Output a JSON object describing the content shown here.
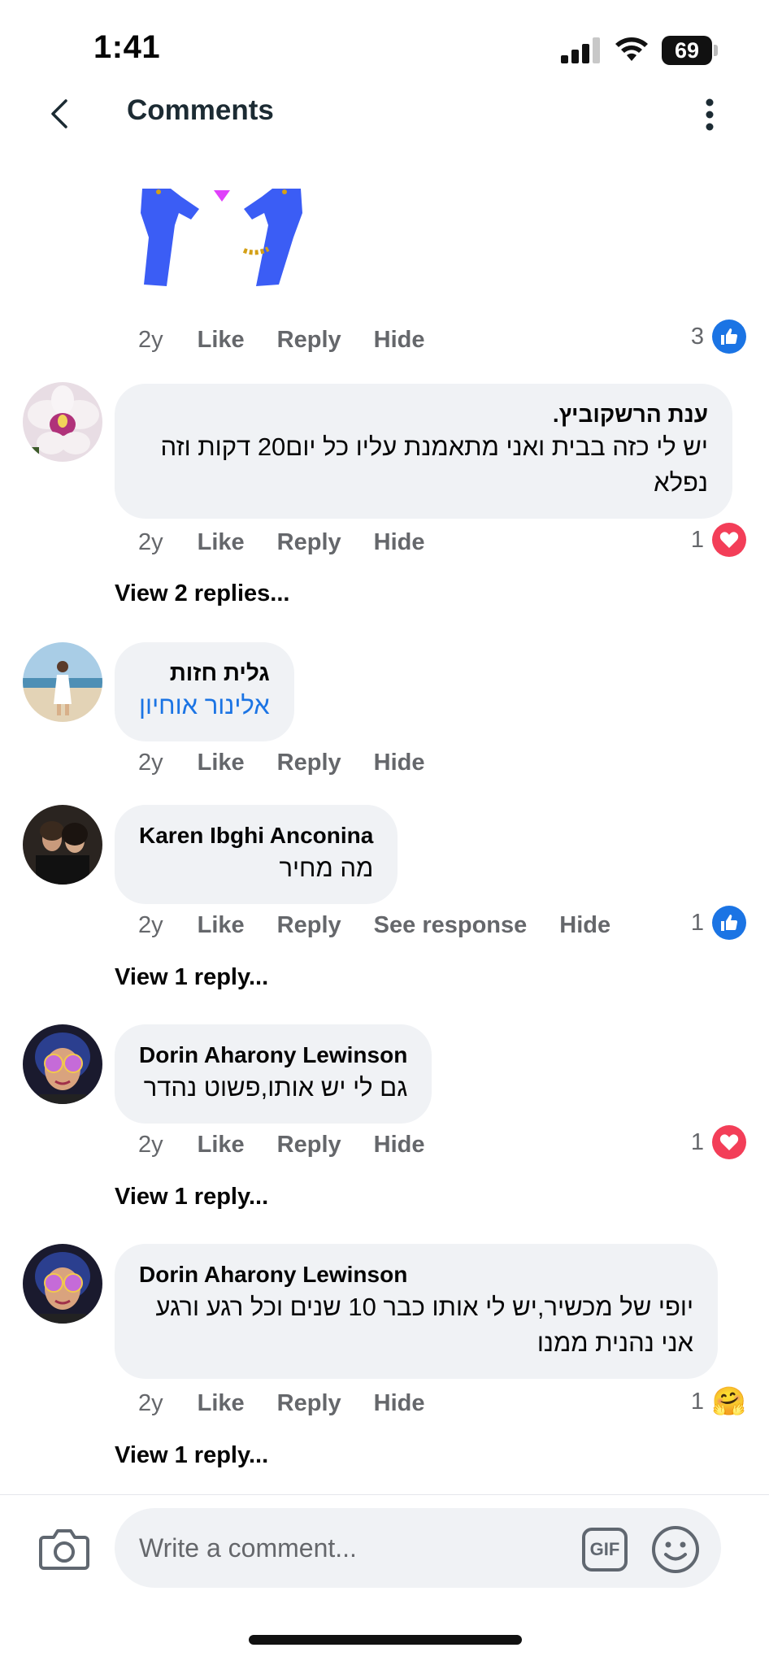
{
  "status_bar": {
    "time": "1:41",
    "battery": "69"
  },
  "header": {
    "title": "Comments"
  },
  "top_comment": {
    "age": "2y",
    "like": "Like",
    "reply": "Reply",
    "hide": "Hide",
    "reaction": {
      "count": "3",
      "type": "like",
      "icon": "like-icon"
    }
  },
  "comments": [
    {
      "author": "ענת הרשקוביץ.",
      "text": "יש לי כזה בבית ואני מתאמנת עליו כל יום20 דקות וזה נפלא",
      "age": "2y",
      "like": "Like",
      "reply": "Reply",
      "hide": "Hide",
      "reaction": {
        "count": "1",
        "type": "love"
      },
      "view_replies": "View 2 replies..."
    },
    {
      "author": "גלית חזות",
      "text": "אלינור אוחיון",
      "age": "2y",
      "like": "Like",
      "reply": "Reply",
      "hide": "Hide"
    },
    {
      "author": "Karen Ibghi Anconina",
      "text": "מה מחיר",
      "age": "2y",
      "like": "Like",
      "reply": "Reply",
      "see_response": "See response",
      "hide": "Hide",
      "reaction": {
        "count": "1",
        "type": "like"
      },
      "view_replies": "View 1 reply..."
    },
    {
      "author": "Dorin Aharony Lewinson",
      "text": "גם לי יש אותו,פשוט נהדר",
      "age": "2y",
      "like": "Like",
      "reply": "Reply",
      "hide": "Hide",
      "reaction": {
        "count": "1",
        "type": "love"
      },
      "view_replies": "View 1 reply..."
    },
    {
      "author": "Dorin Aharony Lewinson",
      "text": "יופי של מכשיר,יש לי אותו כבר 10 שנים וכל רגע ורגע אני נהנית ממנו",
      "age": "2y",
      "like": "Like",
      "reply": "Reply",
      "hide": "Hide",
      "reaction": {
        "count": "1",
        "type": "care",
        "icon": "🤗"
      },
      "view_replies": "View 1 reply..."
    }
  ],
  "composer": {
    "placeholder": "Write a comment...",
    "gif": "GIF"
  },
  "colors": {
    "accent": "#1b74e4",
    "love": "#f33e58",
    "bubble": "#f0f2f5",
    "meta": "#65676b"
  }
}
